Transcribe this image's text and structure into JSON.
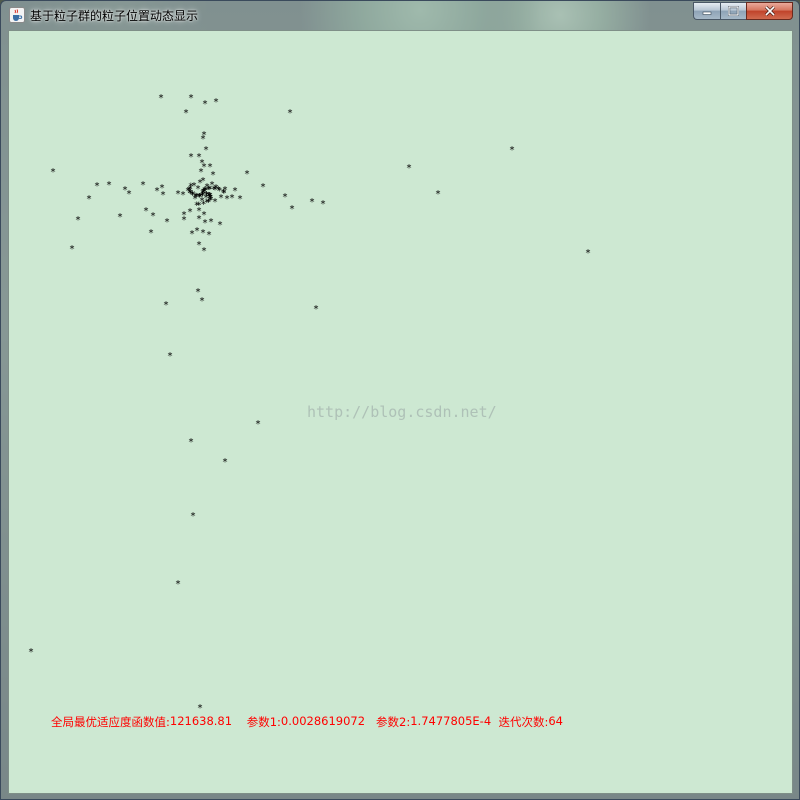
{
  "window": {
    "title": "基于粒子群的粒子位置动态显示",
    "icon": "java-cup-icon",
    "controls": {
      "minimize": "minimize-icon",
      "maximize": "maximize-icon",
      "close": "close-icon"
    }
  },
  "canvas": {
    "background_color": "#cde8d2",
    "marker": "*",
    "marker_color": "#000000"
  },
  "watermark": "http://blog.csdn.net/",
  "status": {
    "best_label": "全局最优适应度函数值:",
    "best_value": "121638.81",
    "param1_label": "参数1:",
    "param1_value": "0.0028619072",
    "param2_label": "参数2:",
    "param2_value": "1.7477805E-4",
    "iter_label": "迭代次数:",
    "iter_value": "64",
    "color": "#ff0000"
  }
}
